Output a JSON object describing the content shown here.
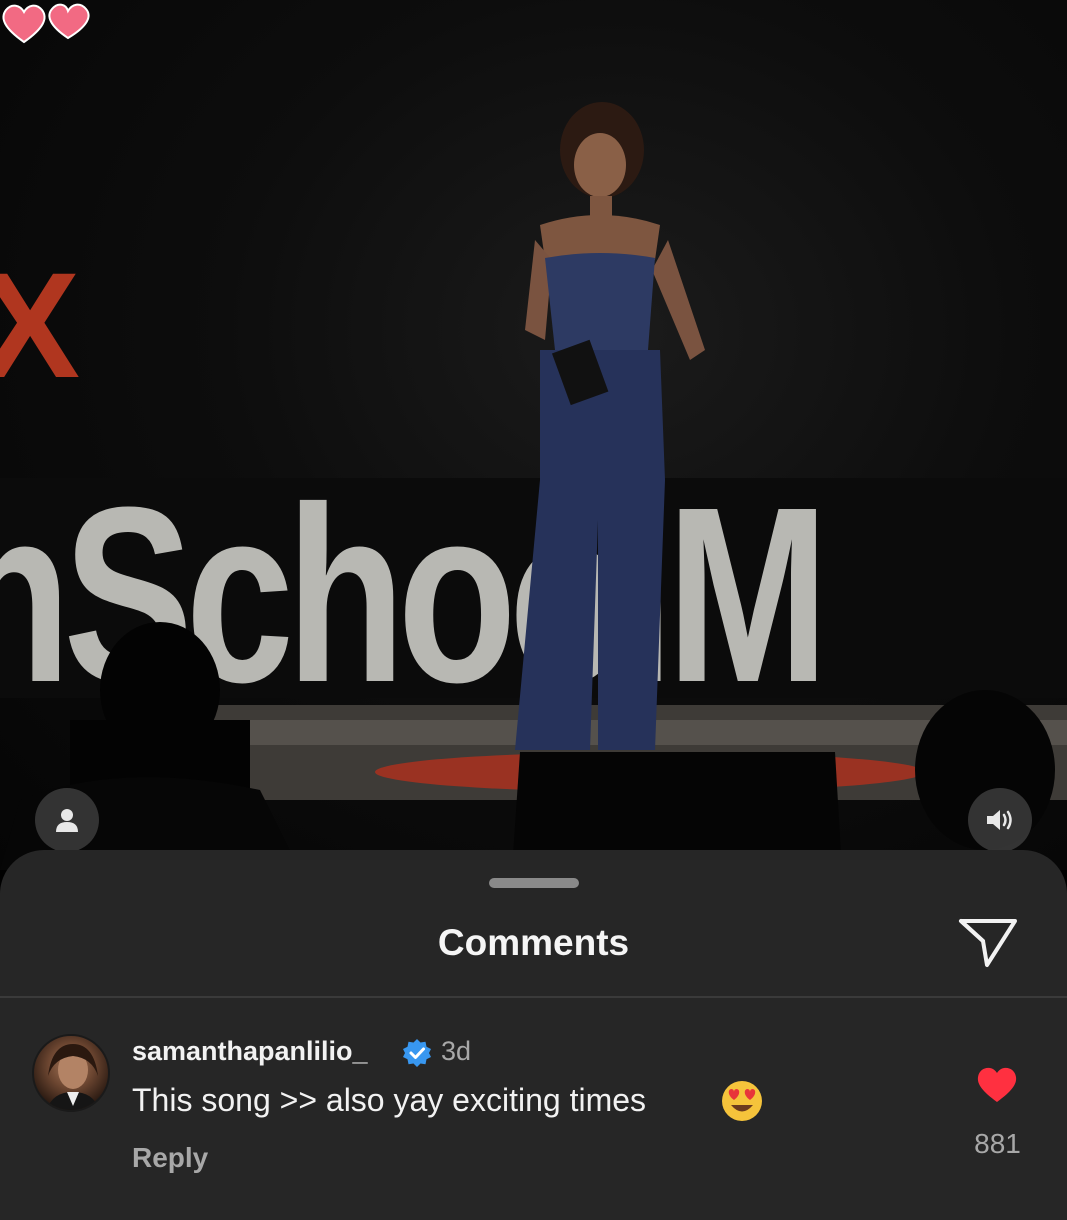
{
  "photo": {
    "stage_sign": "hSchoolM",
    "stage_sign_accent": "X"
  },
  "comments_sheet": {
    "title": "Comments"
  },
  "comments": [
    {
      "username": "samanthapanlilio_",
      "verified": true,
      "time": "3d",
      "text": "This song >> also yay exciting times",
      "emoji": "heart-eyes",
      "reply_label": "Reply",
      "like_count": "881",
      "liked": true
    }
  ],
  "icons": {
    "profile": "person-icon",
    "sound": "speaker-icon",
    "share": "paper-plane-icon",
    "verified": "verified-badge-icon",
    "like": "heart-icon"
  },
  "colors": {
    "sheet_bg": "#262626",
    "like_red": "#ff3040",
    "verified_blue": "#3897f0",
    "sticker_pink": "#f26a83"
  }
}
